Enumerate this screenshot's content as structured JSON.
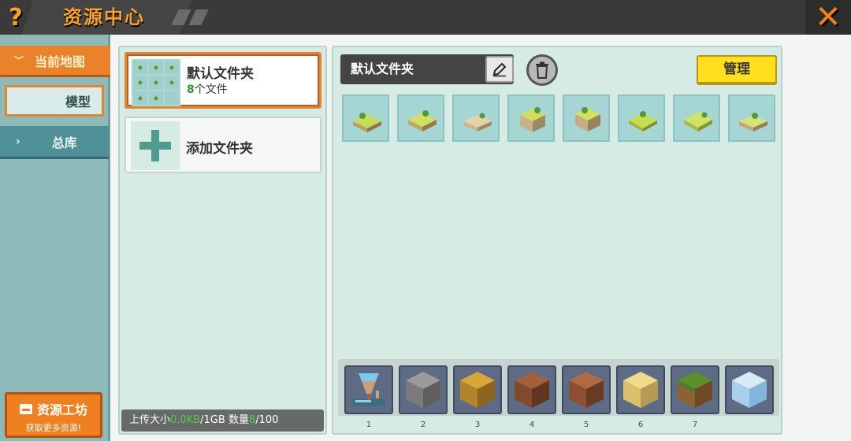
{
  "header": {
    "help_symbol": "?",
    "title": "资源中心",
    "close_symbol": "✕"
  },
  "sidebar": {
    "current_map": "当前地图",
    "model": "模型",
    "library": "总库",
    "workshop_title": "资源工坊",
    "workshop_subtitle": "获取更多资源!"
  },
  "folders": {
    "default_folder": {
      "name": "默认文件夹",
      "count": "8",
      "count_suffix": "个文件"
    },
    "add_folder": "添加文件夹",
    "upload": {
      "prefix": "上传大小",
      "size": "0.0KB",
      "limit": "/1GB",
      "count_label": "数量",
      "count": "8",
      "count_limit": "/100"
    }
  },
  "content": {
    "folder_name": "默认文件夹",
    "manage_label": "管理",
    "model_count": 8
  },
  "hotbar": {
    "slots": [
      {
        "num": "1",
        "item": "drill"
      },
      {
        "num": "2",
        "item": "stone"
      },
      {
        "num": "3",
        "item": "dirt"
      },
      {
        "num": "4",
        "item": "wood"
      },
      {
        "num": "5",
        "item": "log"
      },
      {
        "num": "6",
        "item": "sand"
      },
      {
        "num": "7",
        "item": "grass"
      },
      {
        "num": "",
        "item": "glass"
      }
    ]
  },
  "colors": {
    "accent_orange": "#e9822a",
    "manage_yellow": "#ffe01a",
    "panel_bg": "#d6ebe4",
    "sidebar_bg": "#8db9b9"
  }
}
